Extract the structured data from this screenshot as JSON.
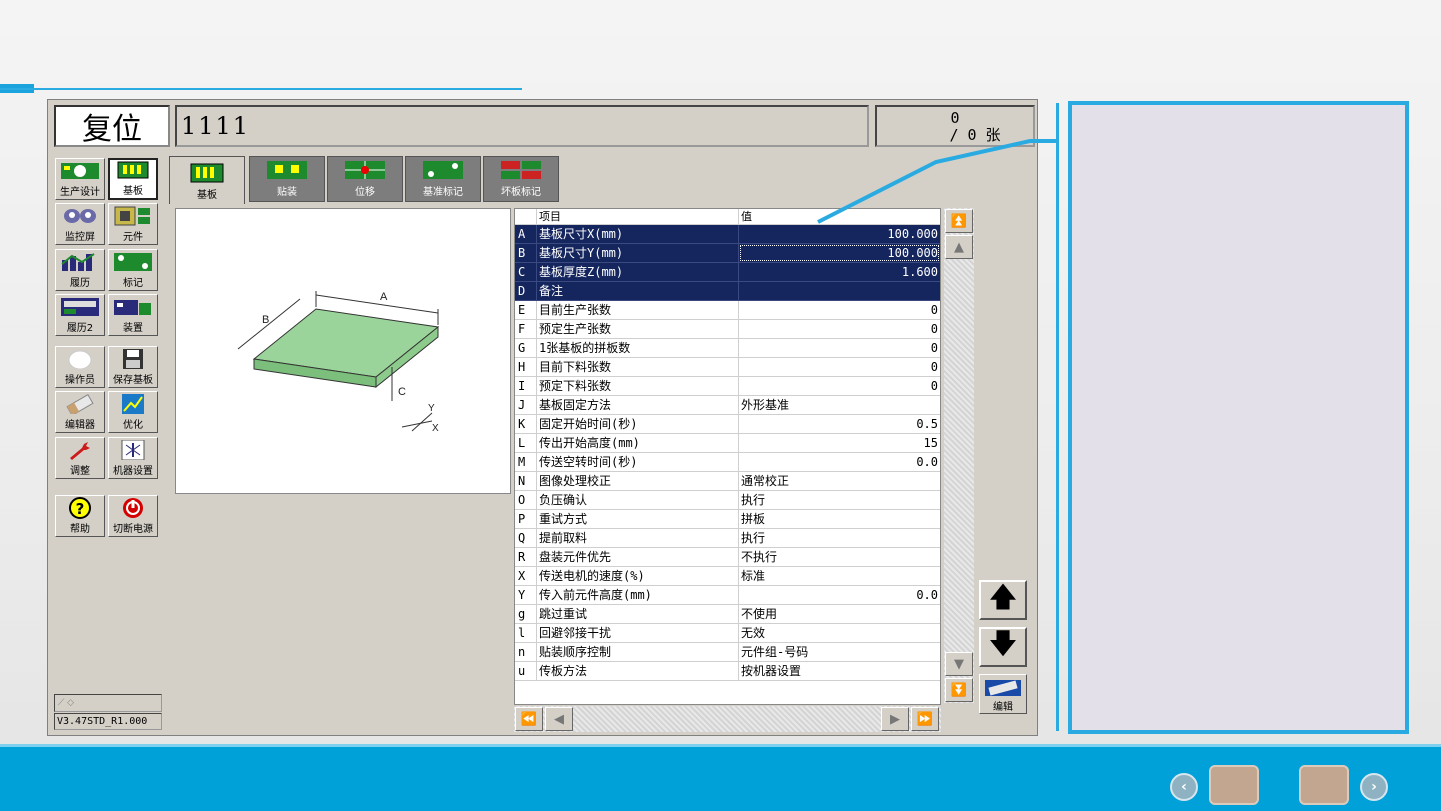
{
  "window": {
    "state": "复位",
    "program_name": "1111",
    "count_line1": "0",
    "count_line2": "/ 0 张",
    "version": "V3.47STD_R1.000"
  },
  "sidebar": {
    "items": [
      {
        "label": "生产设计",
        "icon": "production-design-icon"
      },
      {
        "label": "基板",
        "icon": "board-icon"
      },
      {
        "label": "监控屏",
        "icon": "monitor-icon"
      },
      {
        "label": "元件",
        "icon": "component-icon"
      },
      {
        "label": "履历",
        "icon": "history-icon"
      },
      {
        "label": "标记",
        "icon": "mark-icon"
      },
      {
        "label": "履历2",
        "icon": "history2-icon"
      },
      {
        "label": "装置",
        "icon": "device-icon"
      },
      {
        "label": "操作员",
        "icon": "operator-icon"
      },
      {
        "label": "保存基板",
        "icon": "save-icon"
      },
      {
        "label": "编辑器",
        "icon": "editor-icon"
      },
      {
        "label": "优化",
        "icon": "optimize-icon"
      },
      {
        "label": "调整",
        "icon": "wrench-icon"
      },
      {
        "label": "机器设置",
        "icon": "machine-settings-icon"
      },
      {
        "label": "帮助",
        "icon": "help-icon"
      },
      {
        "label": "切断电源",
        "icon": "power-icon"
      }
    ]
  },
  "tabs": [
    {
      "label": "基板"
    },
    {
      "label": "贴装"
    },
    {
      "label": "位移"
    },
    {
      "label": "基准标记"
    },
    {
      "label": "坏板标记"
    }
  ],
  "diagram": {
    "label_a": "A",
    "label_b": "B",
    "label_c": "C",
    "label_x": "X",
    "label_y": "Y"
  },
  "table": {
    "headers": {
      "item": "项目",
      "value": "值"
    },
    "rows": [
      {
        "key": "A",
        "item": "基板尺寸X(mm)",
        "value": "100.000"
      },
      {
        "key": "B",
        "item": "基板尺寸Y(mm)",
        "value": "100.000"
      },
      {
        "key": "C",
        "item": "基板厚度Z(mm)",
        "value": "1.600"
      },
      {
        "key": "D",
        "item": "备注",
        "value": ""
      },
      {
        "key": "E",
        "item": "目前生产张数",
        "value": "0"
      },
      {
        "key": "F",
        "item": "预定生产张数",
        "value": "0"
      },
      {
        "key": "G",
        "item": "1张基板的拼板数",
        "value": "0"
      },
      {
        "key": "H",
        "item": "目前下料张数",
        "value": "0"
      },
      {
        "key": "I",
        "item": "预定下料张数",
        "value": "0"
      },
      {
        "key": "J",
        "item": "基板固定方法",
        "value": "外形基准"
      },
      {
        "key": "K",
        "item": "固定开始时间(秒)",
        "value": "0.5"
      },
      {
        "key": "L",
        "item": "传出开始高度(mm)",
        "value": "15"
      },
      {
        "key": "M",
        "item": "传送空转时间(秒)",
        "value": "0.0"
      },
      {
        "key": "N",
        "item": "图像处理校正",
        "value": "通常校正"
      },
      {
        "key": "O",
        "item": "负压确认",
        "value": "执行"
      },
      {
        "key": "P",
        "item": "重试方式",
        "value": "拼板"
      },
      {
        "key": "Q",
        "item": "提前取料",
        "value": "执行"
      },
      {
        "key": "R",
        "item": "盘装元件优先",
        "value": "不执行"
      },
      {
        "key": "X",
        "item": "传送电机的速度(%)",
        "value": "标准"
      },
      {
        "key": "Y",
        "item": "传入前元件高度(mm)",
        "value": "0.0"
      },
      {
        "key": "g",
        "item": "跳过重试",
        "value": "不使用"
      },
      {
        "key": "l",
        "item": "回避邻接干扰",
        "value": "无效"
      },
      {
        "key": "n",
        "item": "贴装顺序控制",
        "value": "元件组-号码"
      },
      {
        "key": "u",
        "item": "传板方法",
        "value": "按机器设置"
      }
    ]
  },
  "edit_button_label": "编辑",
  "colors": {
    "accent": "#29abe2",
    "selection": "#15265f",
    "footer": "#00a0d8"
  }
}
